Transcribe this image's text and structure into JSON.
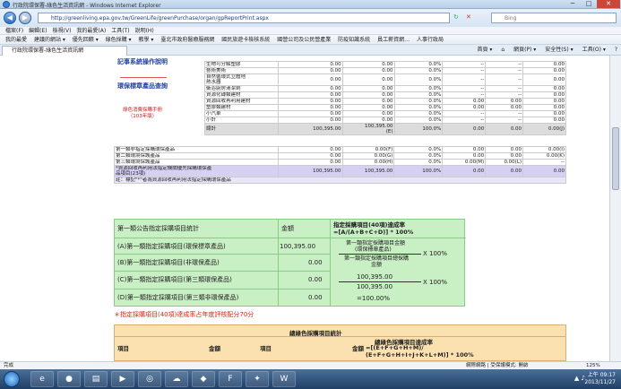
{
  "window": {
    "title": "行政院環保署-綠色生活資訊網 - Windows Internet Explorer",
    "minimize": "─",
    "maximize": "□",
    "close": "✕"
  },
  "address": {
    "url": "http://greenliving.epa.gov.tw/GreenLife/greenPurchase/organ/gpReportPrint.aspx",
    "search_placeholder": "Bing"
  },
  "menu": [
    "檔案(F)",
    "編輯(E)",
    "檢視(V)",
    "我的最愛(A)",
    "工具(T)",
    "說明(H)"
  ],
  "favorites": [
    "我的最愛",
    "建議的網站 ▾",
    "優先回饋 ▾",
    "綠色採購 ▾",
    "教學 ▾",
    "臺北市政府醫療服務網",
    "國民旅遊卡檢核系統",
    "國營公司及公民營產業",
    "防疫知識系統",
    "員工薪資網…",
    "人事行政局"
  ],
  "tab": {
    "label": "行政院環保署-綠色生活資訊網"
  },
  "tools": [
    "首頁 ▾",
    "⌂",
    "網頁(P) ▾",
    "安全性(S) ▾",
    "工具(O) ▾",
    "?"
  ],
  "leftnav": {
    "header": "記事系統操作說明",
    "group": "環保標章產品查詢",
    "red1": "綠色消費採購手冊",
    "red2": "（103年版）"
  },
  "table1": {
    "rows": [
      {
        "name": "生物可分解塑膠",
        "v1": "0.00",
        "v2": "0.00",
        "p": "0.0%",
        "v3": "--",
        "v4": "--",
        "v5": "0.00"
      },
      {
        "name": "藝術美術",
        "v1": "0.00",
        "v2": "0.00",
        "p": "0.0%",
        "v3": "--",
        "v4": "--",
        "v5": "0.00"
      },
      {
        "name": "自然循環式立體地\n熱水器",
        "v1": "0.00",
        "v2": "0.00",
        "p": "0.0%",
        "v3": "--",
        "v4": "--",
        "v5": "0.00"
      },
      {
        "name": "衛浴廚房清潔劑",
        "v1": "0.00",
        "v2": "0.00",
        "p": "0.0%",
        "v3": "--",
        "v4": "--",
        "v5": "0.00"
      },
      {
        "name": "資源化磚類建材",
        "v1": "0.00",
        "v2": "0.00",
        "p": "0.0%",
        "v3": "--",
        "v4": "--",
        "v5": "0.00"
      },
      {
        "name": "資源回收再利用建材",
        "v1": "0.00",
        "v2": "0.00",
        "p": "0.0%",
        "v3": "0.00",
        "v4": "0.00",
        "v5": "0.00"
      },
      {
        "name": "塑膠類建材",
        "v1": "0.00",
        "v2": "0.00",
        "p": "0.0%",
        "v3": "0.00",
        "v4": "0.00",
        "v5": "0.00"
      },
      {
        "name": "小汽車",
        "v1": "0.00",
        "v2": "0.00",
        "p": "0.0%",
        "v3": "--",
        "v4": "--",
        "v5": "0.00"
      },
      {
        "name": "小計",
        "v1": "0.00",
        "v2": "0.00",
        "p": "0.0%",
        "v3": "--",
        "v4": "--",
        "v5": "0.00"
      }
    ],
    "total": {
      "name": "總計",
      "v1": "100,395.00",
      "v2": "100,395.00",
      "v2b": "(E)",
      "p": "100.0%",
      "v3": "0.00",
      "v4": "0.00",
      "v5": "0.00(J)"
    }
  },
  "table2": {
    "rows": [
      {
        "name": "第一類非指定採購環保產品",
        "v1": "0.00",
        "v2": "0.00(F)",
        "p": "0.0%",
        "v3": "0.00",
        "v4": "0.00",
        "v5": "0.00(I)"
      },
      {
        "name": "第二類環境保護產品",
        "v1": "0.00",
        "v2": "0.00(G)",
        "p": "0.0%",
        "v3": "0.00",
        "v4": "0.00",
        "v5": "0.00(K)"
      },
      {
        "name": "第三類環境保護產品",
        "v1": "0.00",
        "v2": "0.00(H)",
        "p": "0.0%",
        "v3": "0.00(M)",
        "v4": "0.00(L)",
        "v5": "--"
      }
    ],
    "resource": {
      "name": "*資源回收再利用法指定機關優先採購環保產\n品項目(23項)",
      "v1": "100,395.00",
      "v2": "100,395.00",
      "p": "100.0%",
      "v3": "0.00",
      "v4": "0.00",
      "v5": "0.00"
    },
    "note": "註：標記\"*\"者為資源回收再利用法指定採購環保產品"
  },
  "section2": {
    "title": "第一類公告指定採購項目統計",
    "amount_header": "金額",
    "rate_header_1": "指定採購項目(40項)達成率",
    "rate_header_2": "=[A/(A+B+C+D)] * 100%",
    "rows": [
      {
        "label": "(A)第一類指定採購項目(環保標章產品)",
        "value": "100,395.00"
      },
      {
        "label": "(B)第一類指定採購項目(非環保產品)",
        "value": "0.00"
      },
      {
        "label": "(C)第一類指定採購項目(第三類環保產品)",
        "value": "0.00"
      },
      {
        "label": "(D)第一類指定採購項目(第三類非環保產品)",
        "value": "0.00"
      }
    ],
    "frac1_top_1": "第一類指定採購項目金額",
    "frac1_top_2": "(環保標章產品)",
    "frac1_bot_1": "第一類指定採購項目總採購",
    "frac1_bot_2": "金額",
    "times1": "X 100%",
    "frac2_top": "100,395.00",
    "frac2_bot": "100,395.00",
    "times2": "X 100%",
    "result": "=100.00%"
  },
  "red_note": "＊指定採購項目(40項)達成率占年度評核配分70分",
  "section3": {
    "title": "總綠色採購項目統計",
    "col_item": "項目",
    "col_amount": "金額",
    "col_item2": "項目",
    "col_amount2": "金額",
    "rate1": "總綠色採購項目達成率",
    "rate2": "=[(E+F+G+H+M)/",
    "rate3": "(E+F+G+H+I+J+K+L+M)] * 100%"
  },
  "status": {
    "left": "完成",
    "zone": "網際網路 | 受保護模式: 開啟",
    "zoom": "125%"
  },
  "taskbar": {
    "time": "上午 09:17",
    "date": "2013/11/27"
  }
}
